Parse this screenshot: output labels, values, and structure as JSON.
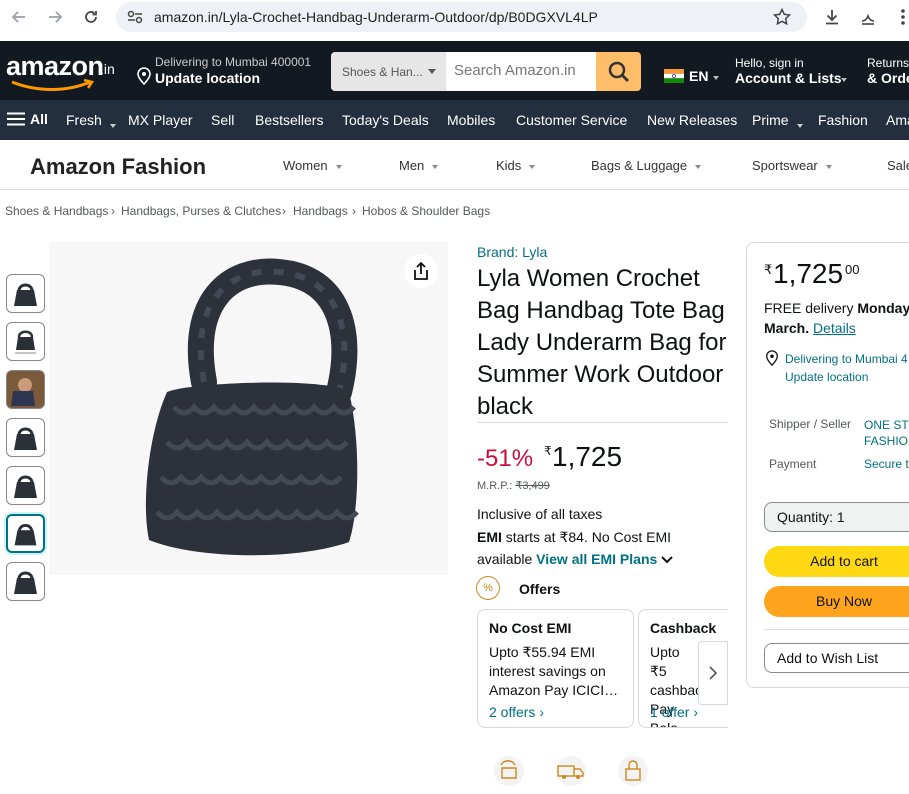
{
  "browser": {
    "url": "amazon.in/Lyla-Crochet-Handbag-Underarm-Outdoor/dp/B0DGXVL4LP"
  },
  "header": {
    "logo": "amazon",
    "logo_suffix": ".in",
    "deliver_line1": "Delivering to Mumbai 400001",
    "deliver_line2": "Update location",
    "search_category": "Shoes & Han...",
    "search_placeholder": "Search Amazon.in",
    "lang": "EN",
    "account_line1": "Hello, sign in",
    "account_line2": "Account & Lists",
    "returns_line1": "Returns",
    "returns_line2": "& Orde"
  },
  "nav2": {
    "all": "All",
    "items": [
      "Fresh",
      "MX Player",
      "Sell",
      "Bestsellers",
      "Today's Deals",
      "Mobiles",
      "Customer Service",
      "New Releases",
      "Prime",
      "Fashion",
      "Ama"
    ]
  },
  "fashion_bar": {
    "title": "Amazon Fashion",
    "items": [
      "Women",
      "Men",
      "Kids",
      "Bags & Luggage",
      "Sportswear",
      "Sale"
    ]
  },
  "breadcrumb": [
    "Shoes & Handbags",
    "Handbags, Purses & Clutches",
    "Handbags",
    "Hobos & Shoulder Bags"
  ],
  "product": {
    "brand": "Brand: Lyla",
    "title": "Lyla Women Crochet Bag Handbag Tote Bag Lady Underarm Bag for Summer Work Outdoor black",
    "discount": "-51%",
    "currency": "₹",
    "price": "1,725",
    "mrp_label": "M.R.P.:",
    "mrp_value": "₹3,499",
    "taxes": "Inclusive of all taxes",
    "emi_bold": "EMI",
    "emi_text": "starts at ₹84. No Cost EMI available",
    "emi_link": "View all EMI Plans"
  },
  "offers": {
    "title": "Offers",
    "cards": [
      {
        "heading": "No Cost EMI",
        "body": "Upto ₹55.94 EMI interest savings on Amazon Pay ICICI…",
        "link": "2 offers"
      },
      {
        "heading": "Cashback",
        "body": "Upto ₹5 cashbac Pay Bala",
        "link": "1 offer"
      }
    ]
  },
  "buybox": {
    "currency": "₹",
    "price": "1,725",
    "fraction": "00",
    "delivery_prefix": "FREE delivery",
    "delivery_date": "Monday,",
    "delivery_month": "March.",
    "details_link": "Details",
    "deliver_to": "Delivering to Mumbai 4",
    "update_location": "Update location",
    "shipper_label": "Shipper / Seller",
    "shipper_value_1": "ONE STO",
    "shipper_value_2": "FASHION",
    "payment_label": "Payment",
    "payment_value": "Secure t",
    "quantity_label": "Quantity:",
    "quantity_value": "1",
    "add_to_cart": "Add to cart",
    "buy_now": "Buy Now",
    "wishlist": "Add to Wish List"
  },
  "colors": {
    "nav_dark": "#131921",
    "nav_secondary": "#232f3e",
    "search_button": "#febd69",
    "add_to_cart": "#ffd814",
    "buy_now": "#ffa41c",
    "discount_red": "#cc0c39",
    "link": "#007185"
  }
}
